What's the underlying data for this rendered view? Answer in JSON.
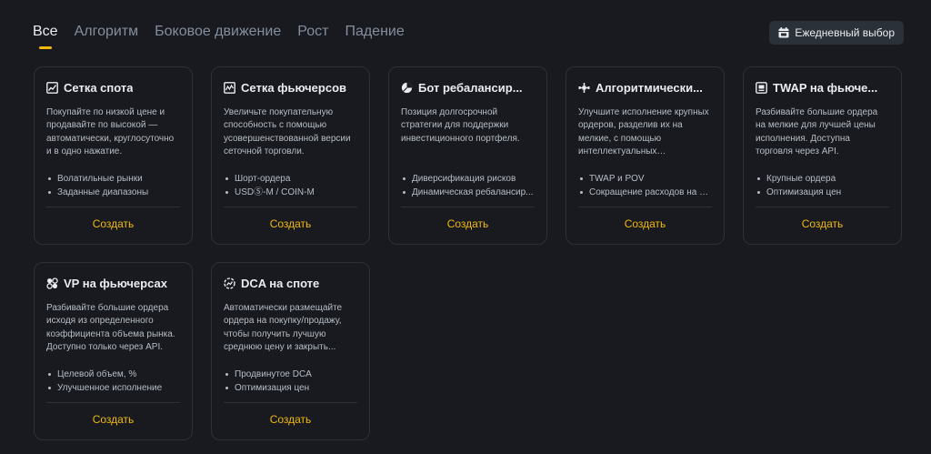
{
  "tabs": [
    {
      "label": "Все",
      "active": true
    },
    {
      "label": "Алгоритм",
      "active": false
    },
    {
      "label": "Боковое движение",
      "active": false
    },
    {
      "label": "Рост",
      "active": false
    },
    {
      "label": "Падение",
      "active": false
    }
  ],
  "daily_button": {
    "label": "Ежедневный выбор",
    "icon": "calendar-icon"
  },
  "create_label": "Создать",
  "colors": {
    "accent": "#f0b90b",
    "background": "#181a20",
    "border": "#2b3139"
  },
  "cards": [
    {
      "icon": "spot-grid-icon",
      "title": "Сетка спота",
      "desc": "Покупайте по низкой цене и продавайте по высокой — автоматически, круглосуточно и в одно нажатие.",
      "features": [
        "Волатильные рынки",
        "Заданные диапазоны"
      ]
    },
    {
      "icon": "futures-grid-icon",
      "title": "Сетка фьючерсов",
      "desc": "Увеличьте покупательную способность с помощью усовершенствованной версии сеточной торговли.",
      "features": [
        "Шорт-ордера",
        "USDⓈ-M / COIN-M"
      ]
    },
    {
      "icon": "pie-chart-icon",
      "title": "Бот ребалансир...",
      "desc": "Позиция долгосрочной стратегии для поддержки инвестиционного портфеля.",
      "features": [
        "Диверсификация рисков",
        "Динамическая ребалансир..."
      ]
    },
    {
      "icon": "algorithm-icon",
      "title": "Алгоритмически...",
      "desc": "Улучшите исполнение крупных ордеров, разделив их на мелкие, с помощью интеллектуальных алгоритмических ордеров. Так...",
      "features": [
        "TWAP и POV",
        "Сокращение расходов на и..."
      ]
    },
    {
      "icon": "twap-icon",
      "title": "TWAP на фьюче...",
      "desc": "Разбивайте большие ордера на мелкие для лучшей цены исполнения. Доступна торговля через API.",
      "features": [
        "Крупные ордера",
        "Оптимизация цен"
      ]
    },
    {
      "icon": "vp-icon",
      "title": "VP на фьючерсах",
      "desc": "Разбивайте большие ордера исходя из определенного коэффициента объема рынка. Доступно только через API.",
      "features": [
        "Целевой объем, %",
        "Улучшенное исполнение"
      ]
    },
    {
      "icon": "dca-icon",
      "title": "DCA на споте",
      "desc": "Автоматически размещайте ордера на покупку/продажу, чтобы получить лучшую среднюю цену и закрыть...",
      "features": [
        "Продвинутое DCA",
        "Оптимизация цен"
      ]
    }
  ]
}
